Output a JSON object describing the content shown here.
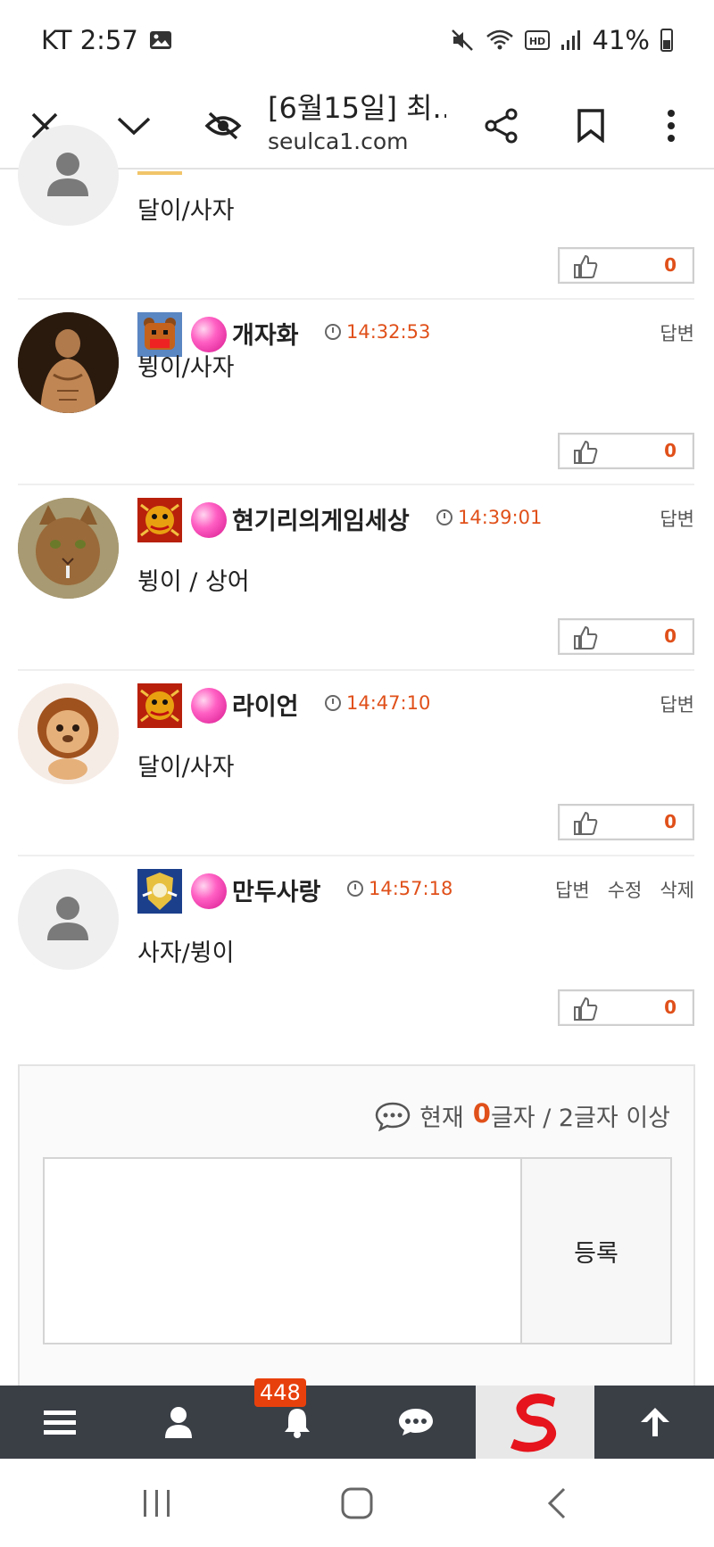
{
  "status_bar": {
    "carrier_time": "KT 2:57",
    "battery": "41%"
  },
  "browser": {
    "page_title": "[6월15일] 최...",
    "domain": "seulca1.com"
  },
  "partial_comment": {
    "body": "달이/사자",
    "likes": "0"
  },
  "comments": [
    {
      "nickname": "개자화",
      "time": "14:32:53",
      "body": "뷩이/사자",
      "likes": "0",
      "reply": "답변"
    },
    {
      "nickname": "현기리의게임세상",
      "time": "14:39:01",
      "body": "뷩이 / 상어",
      "likes": "0",
      "reply": "답변"
    },
    {
      "nickname": "라이언",
      "time": "14:47:10",
      "body": "달이/사자",
      "likes": "0",
      "reply": "답변"
    },
    {
      "nickname": "만두사랑",
      "time": "14:57:18",
      "body": "사자/뷩이",
      "likes": "0",
      "reply": "답변",
      "edit": "수정",
      "delete": "삭제"
    }
  ],
  "write_box": {
    "count_prefix": "현재",
    "count_value": "0",
    "count_suffix": "글자 / 2글자 이상",
    "submit_label": "등록"
  },
  "bottom_nav": {
    "notification_count": "448"
  },
  "colors": {
    "accent": "#e0501a",
    "nav_bg": "#3a3f46",
    "badge": "#e8400c"
  }
}
